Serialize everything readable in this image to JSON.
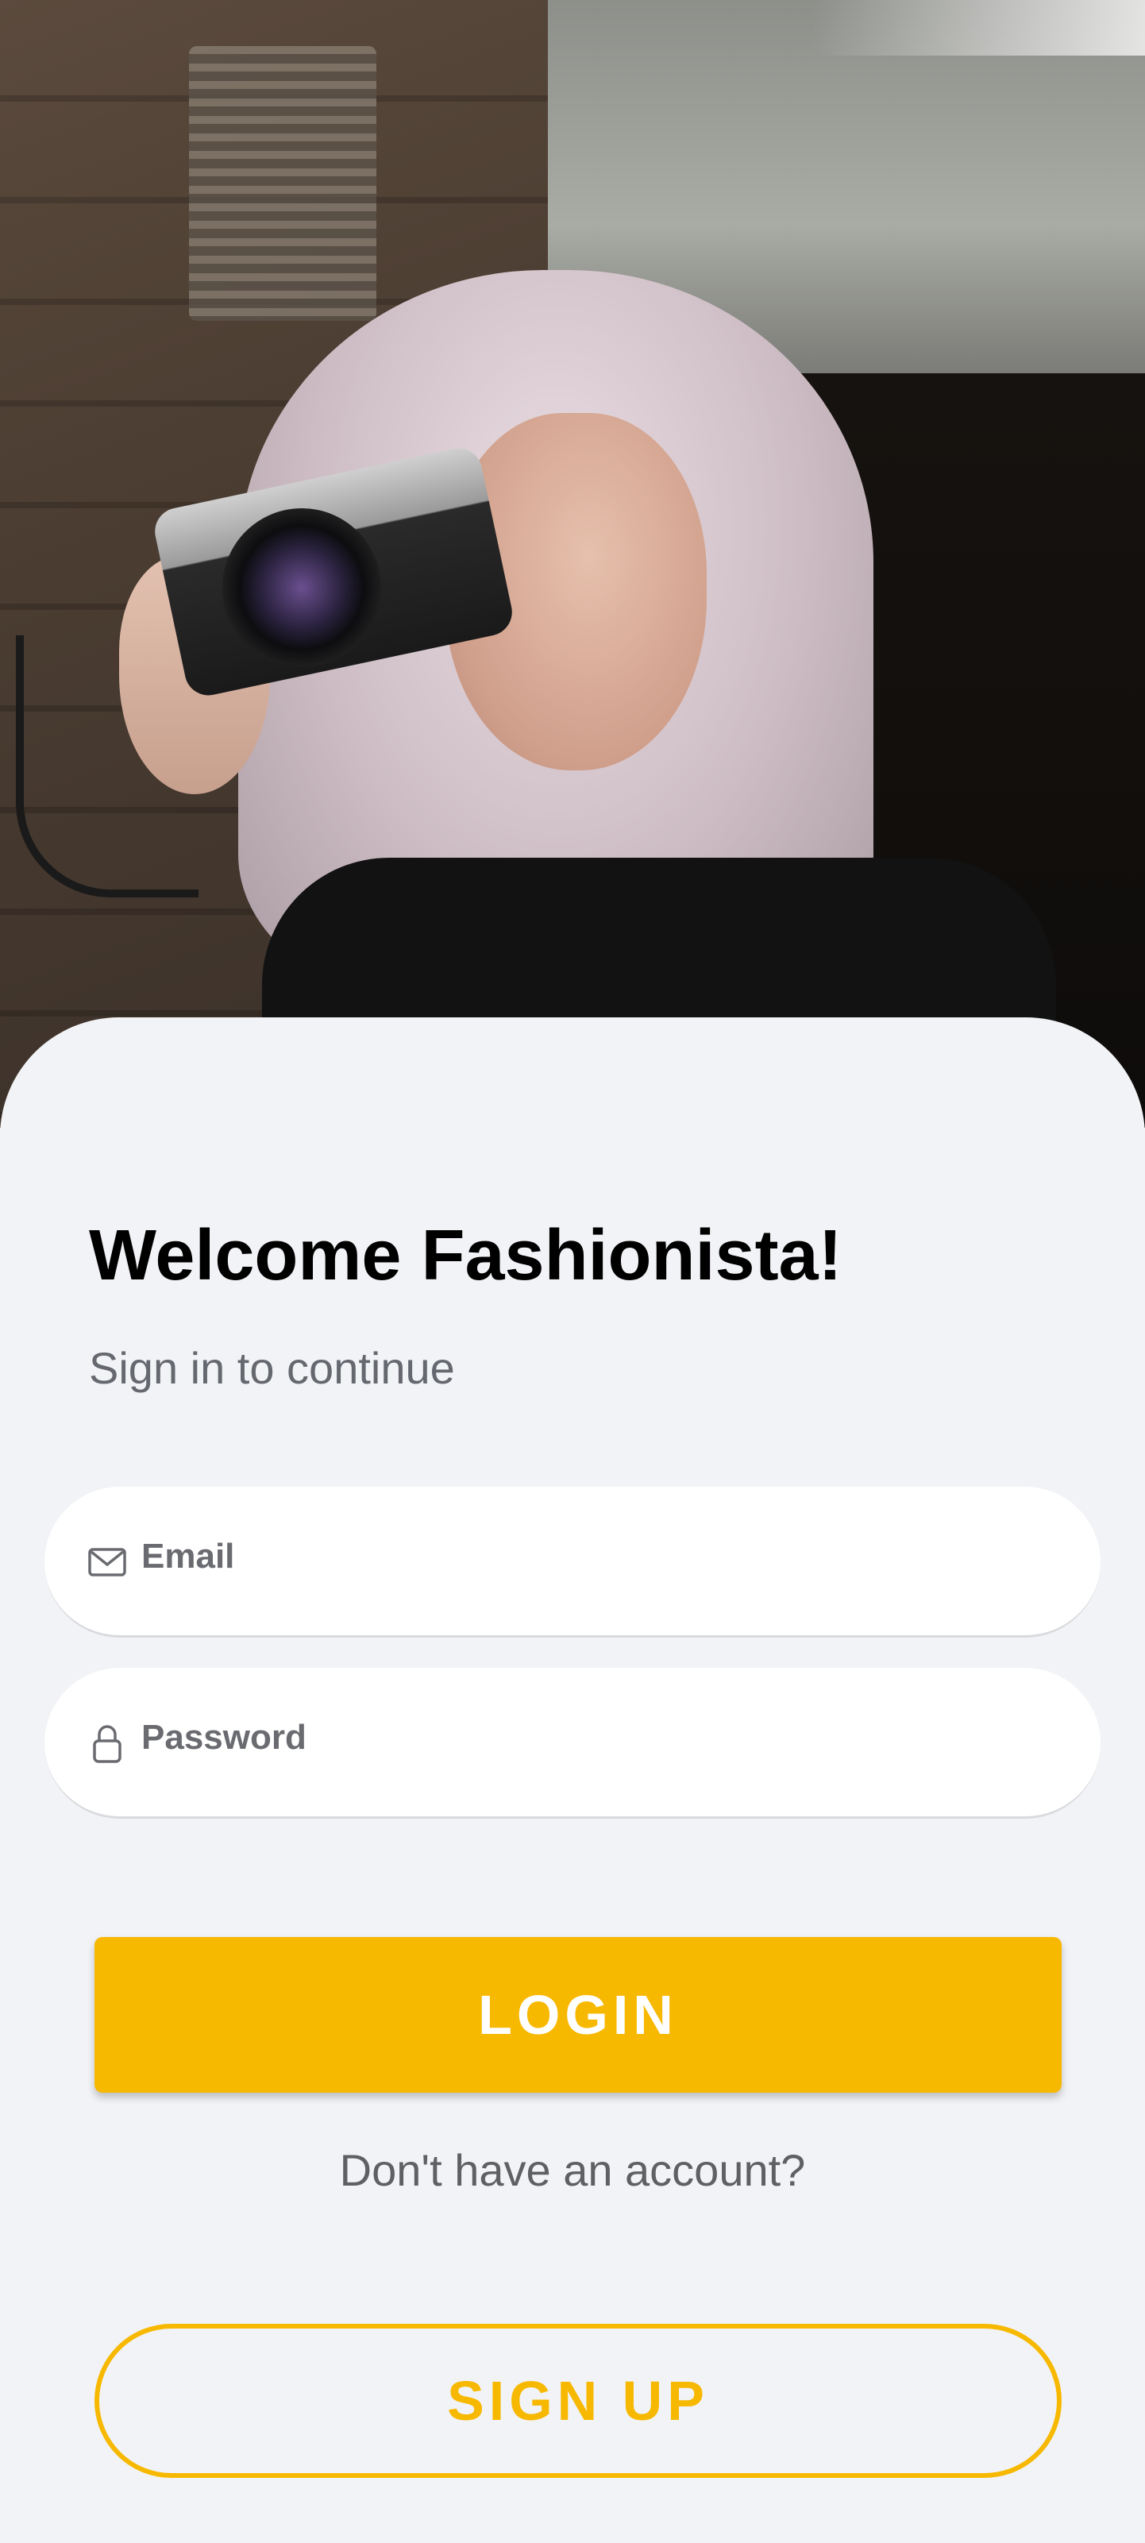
{
  "hero": {
    "image": "woman-with-camera-photo"
  },
  "welcome": {
    "title": "Welcome Fashionista!",
    "subtitle": "Sign in to continue"
  },
  "form": {
    "email": {
      "label": "Email",
      "value": "",
      "icon": "mail-icon"
    },
    "password": {
      "label": "Password",
      "value": "",
      "icon": "lock-icon"
    }
  },
  "actions": {
    "login_label": "LOGIN",
    "no_account_text": "Don't have an account?",
    "signup_label": "SIGN UP"
  },
  "colors": {
    "accent": "#f7b800",
    "background": "#f2f3f6",
    "field_bg": "#ffffff",
    "muted_text": "#666870"
  }
}
